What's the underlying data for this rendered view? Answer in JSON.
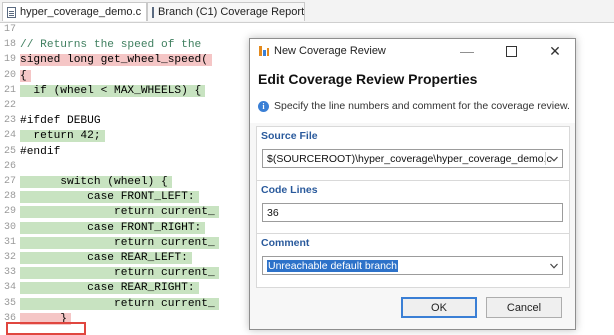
{
  "tabs": [
    {
      "label": "hyper_coverage_demo.c",
      "icon": "c-source-file-icon"
    },
    {
      "label": "Branch (C1) Coverage Report",
      "icon": "report-file-icon"
    }
  ],
  "editor": {
    "lines": [
      {
        "num": "17",
        "code": "",
        "status": "none"
      },
      {
        "num": "18",
        "code": "// Returns the speed of the",
        "status": "none",
        "color": "#3f7f5f"
      },
      {
        "num": "19",
        "code": "signed long get_wheel_speed(",
        "status": "red"
      },
      {
        "num": "20",
        "code": "{",
        "status": "red"
      },
      {
        "num": "21",
        "code": "  if (wheel < MAX_WHEELS) {",
        "status": "green"
      },
      {
        "num": "22",
        "code": "",
        "status": "none"
      },
      {
        "num": "23",
        "code": "#ifdef DEBUG",
        "status": "none"
      },
      {
        "num": "24",
        "code": "  return 42;",
        "status": "green"
      },
      {
        "num": "25",
        "code": "#endif",
        "status": "none"
      },
      {
        "num": "26",
        "code": "",
        "status": "none"
      },
      {
        "num": "27",
        "code": "      switch (wheel) {",
        "status": "green"
      },
      {
        "num": "28",
        "code": "          case FRONT_LEFT:",
        "status": "green"
      },
      {
        "num": "29",
        "code": "              return current_",
        "status": "green"
      },
      {
        "num": "30",
        "code": "          case FRONT_RIGHT:",
        "status": "green"
      },
      {
        "num": "31",
        "code": "              return current_",
        "status": "green"
      },
      {
        "num": "32",
        "code": "          case REAR_LEFT:",
        "status": "green"
      },
      {
        "num": "33",
        "code": "              return current_",
        "status": "green"
      },
      {
        "num": "34",
        "code": "          case REAR_RIGHT:",
        "status": "green"
      },
      {
        "num": "35",
        "code": "              return current_",
        "status": "green"
      },
      {
        "num": "36",
        "code": "      }",
        "status": "red"
      }
    ],
    "highlight_color": "#e0463f"
  },
  "dialog": {
    "window_title": "New Coverage Review",
    "window_buttons": {
      "minimize": "—",
      "close": "✕"
    },
    "heading": "Edit Coverage Review Properties",
    "info_text": "Specify the line numbers and comment for the coverage review.",
    "source_file": {
      "label": "Source File",
      "value": "$(SOURCEROOT)\\hyper_coverage\\hyper_coverage_demo.c"
    },
    "code_lines": {
      "label": "Code Lines",
      "value": "36"
    },
    "comment": {
      "label": "Comment",
      "value": "Unreachable default branch"
    },
    "ok_label": "OK",
    "cancel_label": "Cancel",
    "accent_color": "#3a7fd5"
  }
}
